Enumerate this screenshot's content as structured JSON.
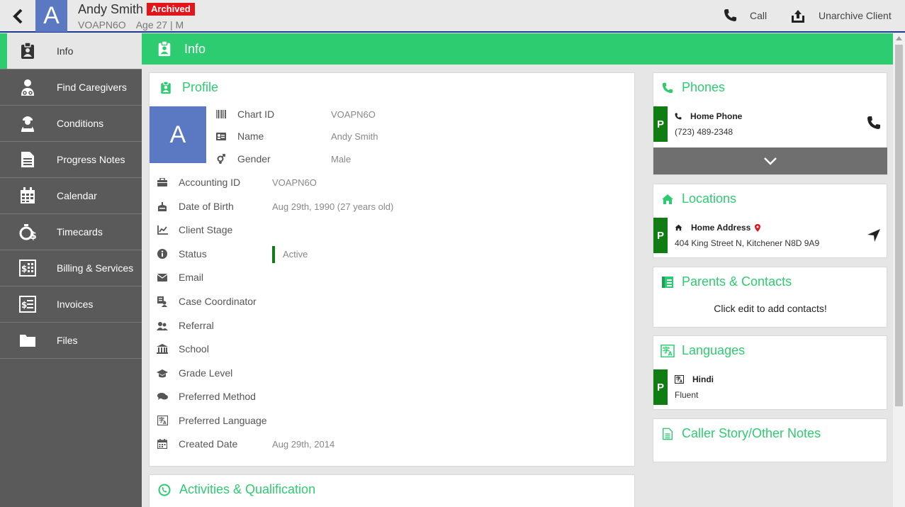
{
  "header": {
    "avatar_letter": "A",
    "name": "Andy Smith",
    "badge": "Archived",
    "id": "VOAPN6O",
    "meta": "Age 27 | M",
    "actions": {
      "call": "Call",
      "unarchive": "Unarchive Client"
    }
  },
  "sidebar": {
    "items": [
      {
        "label": "Info",
        "icon": "id-badge-icon",
        "active": true
      },
      {
        "label": "Find Caregivers",
        "icon": "nurse-icon"
      },
      {
        "label": "Conditions",
        "icon": "patient-icon"
      },
      {
        "label": "Progress Notes",
        "icon": "document-icon"
      },
      {
        "label": "Calendar",
        "icon": "calendar-icon"
      },
      {
        "label": "Timecards",
        "icon": "stopwatch-dollar-icon"
      },
      {
        "label": "Billing & Services",
        "icon": "billing-icon"
      },
      {
        "label": "Invoices",
        "icon": "invoice-icon"
      },
      {
        "label": "Files",
        "icon": "folder-icon"
      }
    ]
  },
  "page": {
    "title": "Info"
  },
  "profile": {
    "title": "Profile",
    "avatar_letter": "A",
    "top_fields": [
      {
        "label": "Chart ID",
        "value": "VOAPN6O",
        "icon": "barcode-icon"
      },
      {
        "label": "Name",
        "value": "Andy Smith",
        "icon": "id-card-icon"
      },
      {
        "label": "Gender",
        "value": "Male",
        "icon": "gender-icon"
      }
    ],
    "fields": [
      {
        "label": "Accounting ID",
        "value": "VOAPN6O",
        "icon": "briefcase-icon"
      },
      {
        "label": "Date of Birth",
        "value": "Aug 29th, 1990 (27 years old)",
        "icon": "cake-icon"
      },
      {
        "label": "Client Stage",
        "value": "",
        "icon": "line-chart-icon"
      },
      {
        "label": "Status",
        "value": "Active",
        "icon": "info-icon"
      },
      {
        "label": "Email",
        "value": "",
        "icon": "envelope-icon"
      },
      {
        "label": "Case Coordinator",
        "value": "",
        "icon": "coordinator-icon"
      },
      {
        "label": "Referral",
        "value": "",
        "icon": "users-icon"
      },
      {
        "label": "School",
        "value": "",
        "icon": "school-icon"
      },
      {
        "label": "Grade Level",
        "value": "",
        "icon": "graduation-cap-icon"
      },
      {
        "label": "Preferred Method",
        "value": "",
        "icon": "chat-icon"
      },
      {
        "label": "Preferred Language",
        "value": "",
        "icon": "language-icon"
      },
      {
        "label": "Created Date",
        "value": "Aug 29th, 2014",
        "icon": "calendar-icon"
      }
    ]
  },
  "activities": {
    "title": "Activities & Qualification"
  },
  "phones": {
    "title": "Phones",
    "primary_tag": "P",
    "label": "Home Phone",
    "number": "(723) 489-2348"
  },
  "locations": {
    "title": "Locations",
    "primary_tag": "P",
    "label": "Home Address",
    "address": "404 King Street N, Kitchener N8D 9A9"
  },
  "contacts": {
    "title": "Parents & Contacts",
    "empty_text": "Click edit to add contacts!"
  },
  "languages": {
    "title": "Languages",
    "primary_tag": "P",
    "language": "Hindi",
    "level": "Fluent"
  },
  "notes": {
    "title": "Caller Story/Other Notes"
  },
  "colors": {
    "accent": "#2ecc71",
    "primary_tag": "#0f7d12",
    "badge": "#e3151b",
    "avatar": "#5b79c2",
    "sidebar": "#5a5a5a"
  }
}
